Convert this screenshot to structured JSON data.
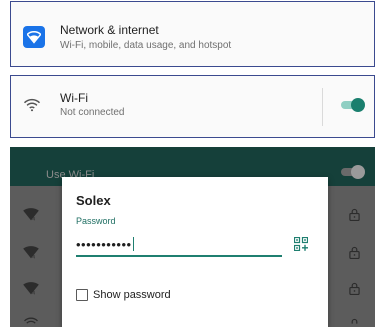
{
  "network_card": {
    "title": "Network & internet",
    "subtitle": "Wi-Fi, mobile, data usage, and hotspot",
    "icon": "wifi-icon",
    "icon_bg": "#1a73e8"
  },
  "wifi_card": {
    "title": "Wi-Fi",
    "subtitle": "Not connected",
    "toggle_on": true,
    "accent": "#1a7f6e"
  },
  "background_list": {
    "header_label": "Use Wi-Fi",
    "rows": [
      {
        "icon": "wifi-signal-icon",
        "secured": true
      },
      {
        "icon": "wifi-signal-icon",
        "secured": true
      },
      {
        "icon": "wifi-signal-icon",
        "secured": true
      },
      {
        "icon": "wifi-signal-icon",
        "secured": true
      }
    ]
  },
  "dialog": {
    "network_name": "Solex",
    "password_label": "Password",
    "password_value": "•••••••••••",
    "qr_icon": "qr-code-scan-icon",
    "show_password_label": "Show password",
    "show_password_checked": false
  }
}
